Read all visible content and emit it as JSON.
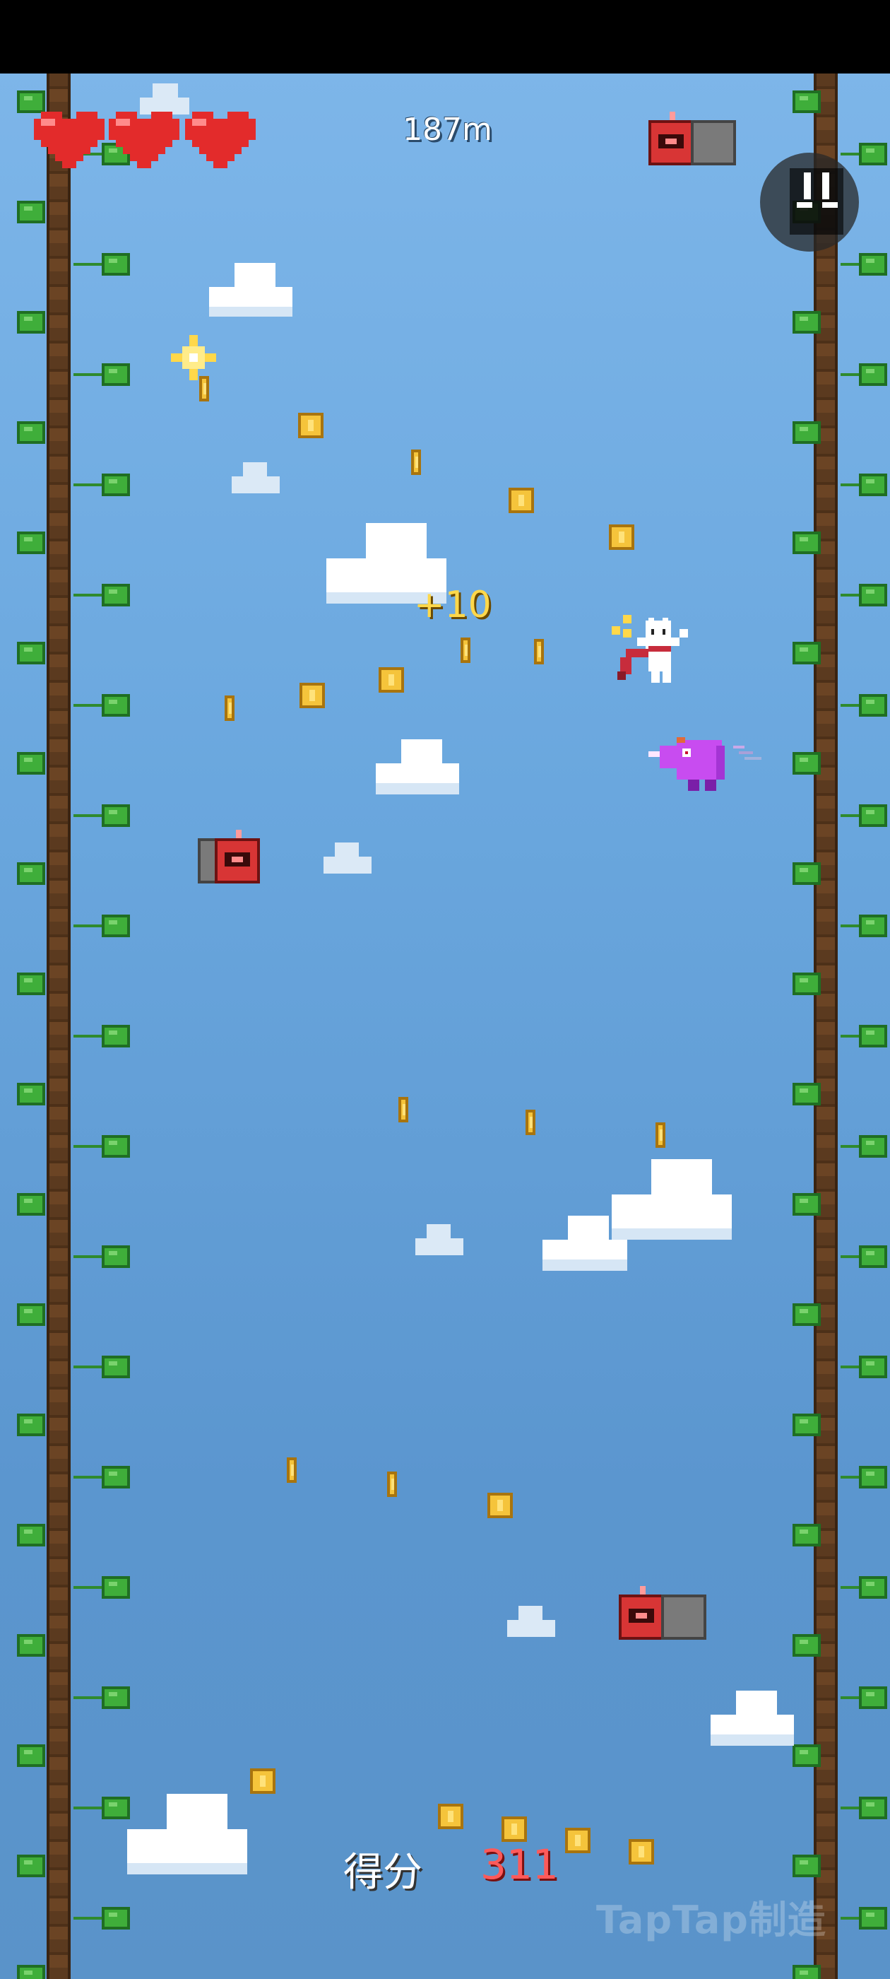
{
  "hud": {
    "distance": "187m",
    "lives": 3,
    "heart_color": "#e32b2b",
    "pause_icon": "pause-icon"
  },
  "popup": {
    "bonus": "+10"
  },
  "score": {
    "label": "得分",
    "value": "311"
  },
  "watermark": "TapTap制造",
  "colors": {
    "sky_top": "#7fb7ea",
    "sky_bottom": "#5a93c9",
    "coin": "#f5c43b",
    "dragon": "#c84cf0"
  },
  "icons": [
    "heart-icon",
    "coin-icon",
    "cloud-icon",
    "robot-enemy-icon",
    "dragon-enemy-icon",
    "player-cat-icon",
    "sparkle-icon",
    "pause-icon"
  ]
}
